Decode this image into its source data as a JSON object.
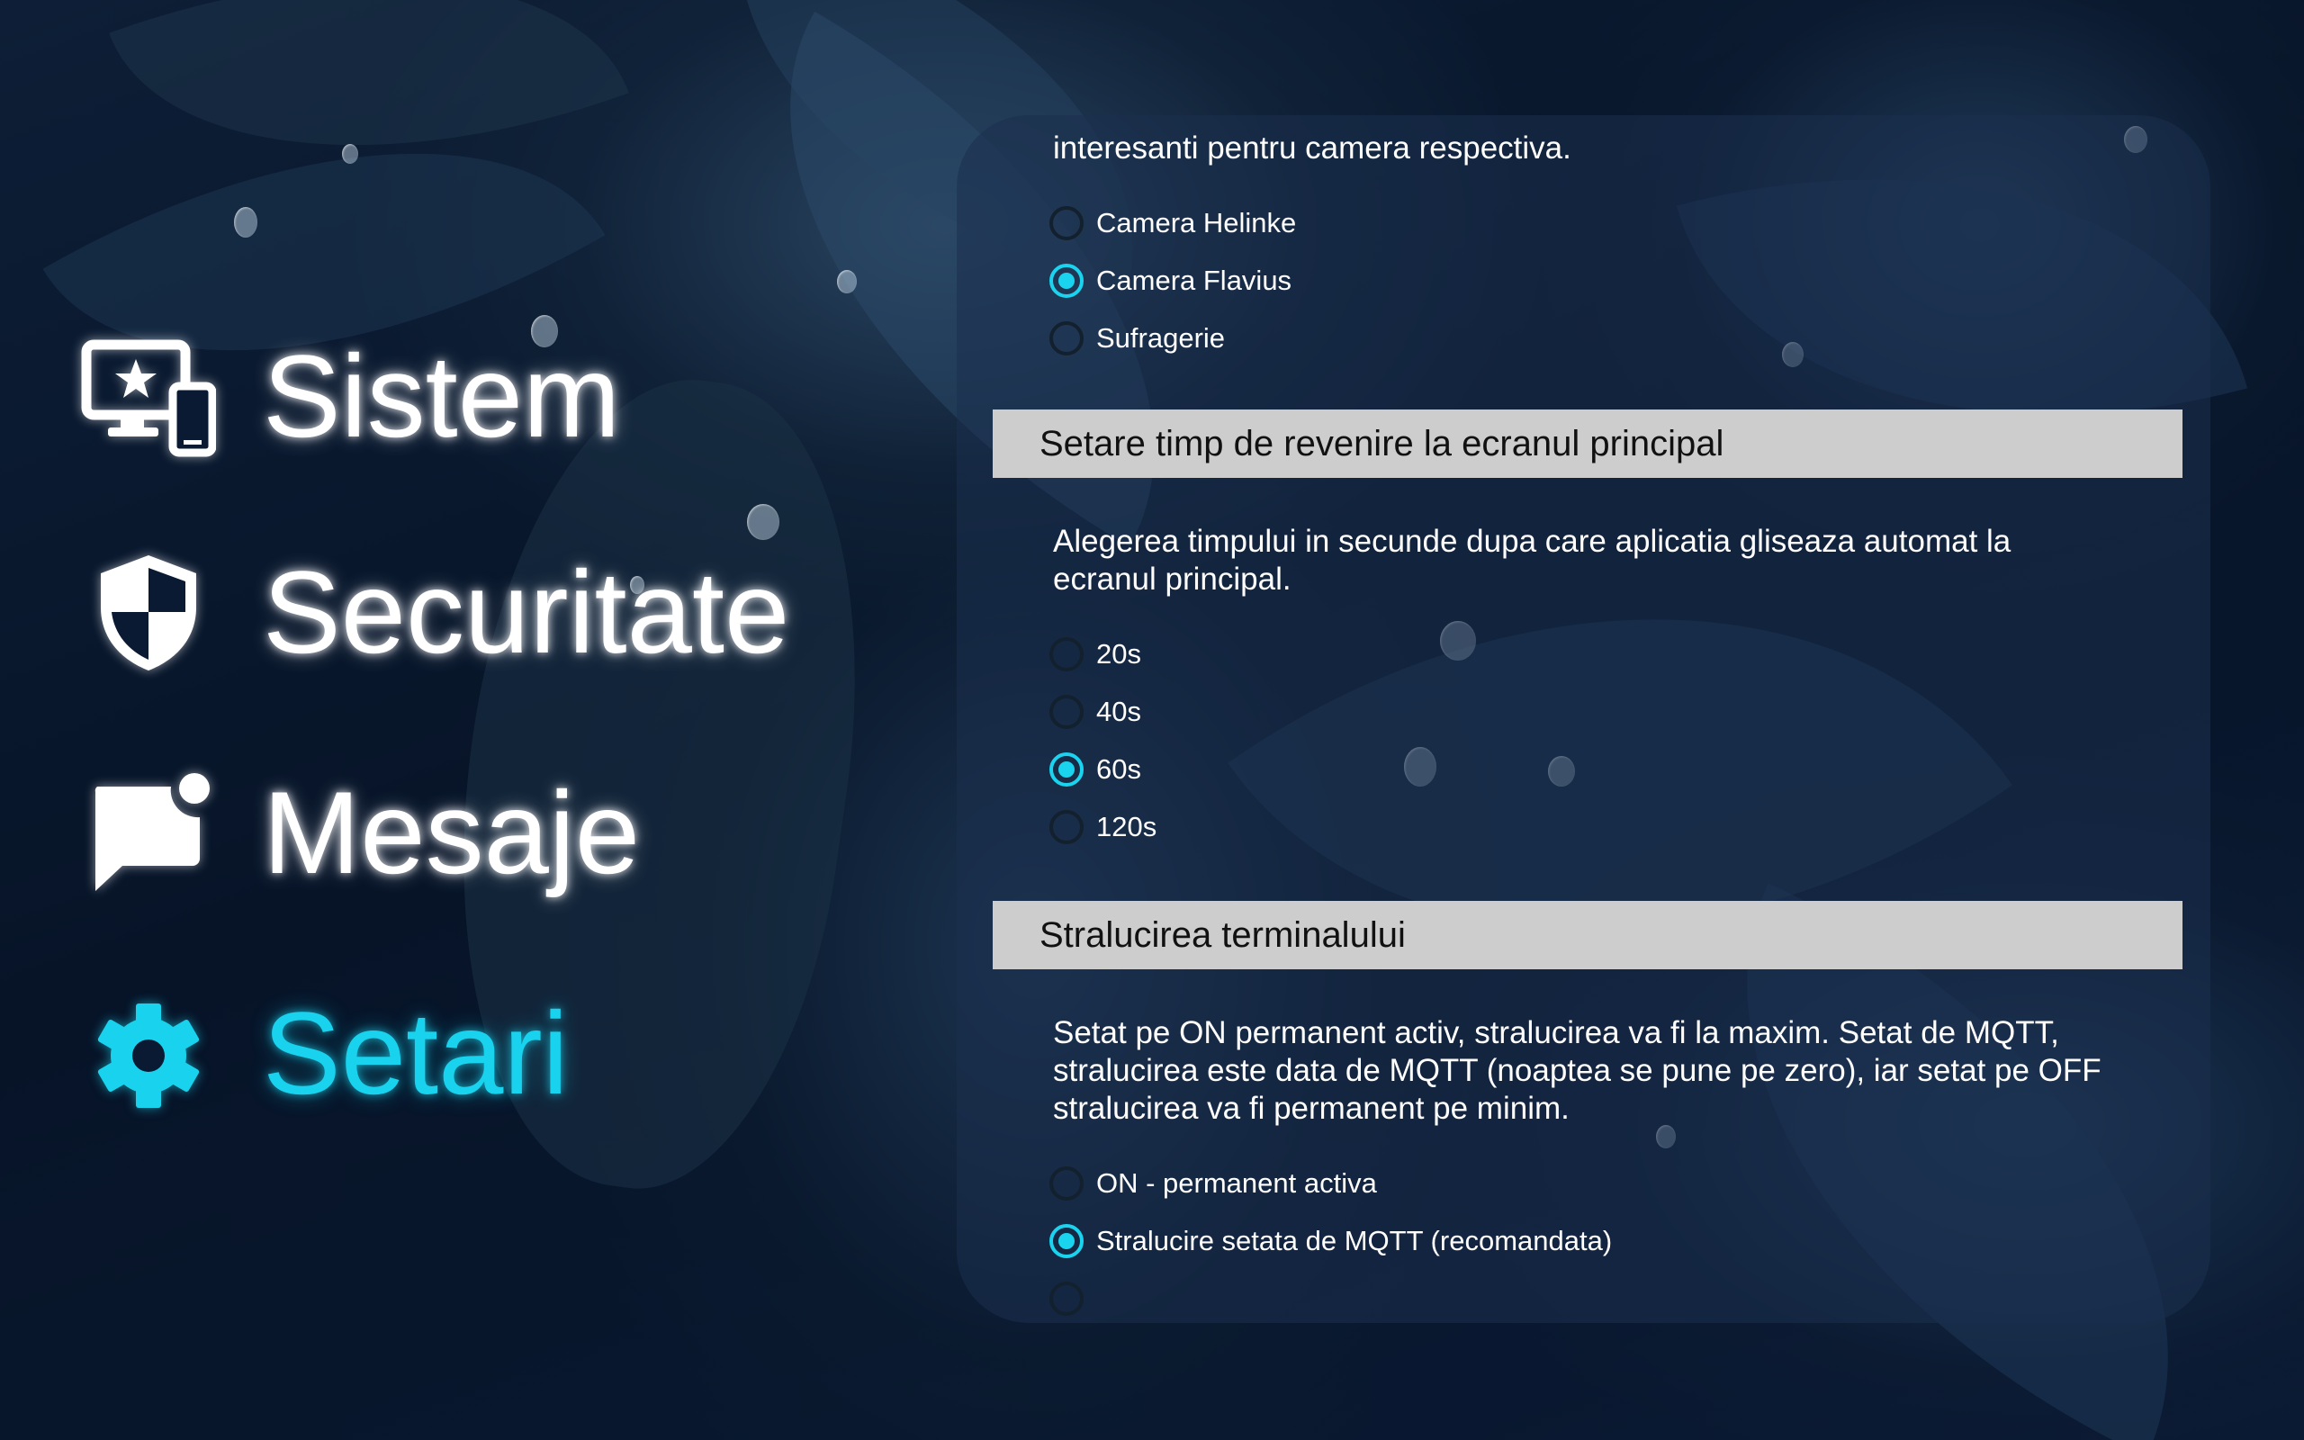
{
  "colors": {
    "accent": "#1ad4ef",
    "section_header_bg": "#cdcdcd",
    "panel_bg": "rgba(28,48,78,0.55)"
  },
  "nav": {
    "items": [
      {
        "label": "Sistem",
        "icon": "monitor-star-devices-icon",
        "active": false
      },
      {
        "label": "Securitate",
        "icon": "shield-icon",
        "active": false
      },
      {
        "label": "Mesaje",
        "icon": "message-notification-icon",
        "active": false
      },
      {
        "label": "Setari",
        "icon": "gear-icon",
        "active": true
      }
    ]
  },
  "settings": {
    "camera": {
      "description_tail": "interesanti pentru camera respectiva.",
      "options": [
        "Camera Helinke",
        "Camera Flavius",
        "Sufragerie"
      ],
      "selected": "Camera Flavius"
    },
    "return_time": {
      "title": "Setare timp de revenire la ecranul principal",
      "description": "Alegerea timpului in secunde dupa care aplicatia gliseaza automat la ecranul principal.",
      "options": [
        "20s",
        "40s",
        "60s",
        "120s"
      ],
      "selected": "60s"
    },
    "brightness": {
      "title": "Stralucirea terminalului",
      "description": "Setat pe ON permanent activ, stralucirea va fi la maxim. Setat de MQTT, stralucirea este data de MQTT (noaptea se pune pe zero), iar setat pe OFF stralucirea va fi permanent pe minim.",
      "options": [
        "ON - permanent activa",
        "Stralucire setata de MQTT (recomandata)"
      ],
      "selected": "Stralucire setata de MQTT (recomandata)"
    }
  }
}
